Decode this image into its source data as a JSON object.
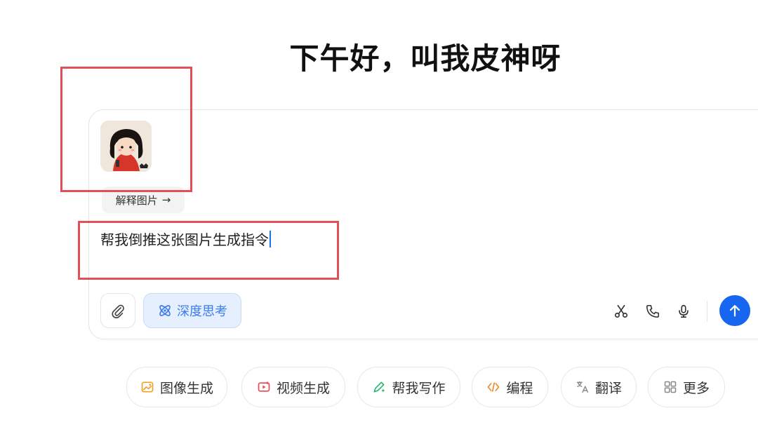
{
  "greeting": "下午好，叫我皮神呀",
  "attachment": {
    "image_icon": "cartoon-girl-image",
    "explain_chip": {
      "label": "解释图片",
      "arrow": "→"
    }
  },
  "input": {
    "value": "帮我倒推这张图片生成指令"
  },
  "toolbar": {
    "attach_icon": "paperclip-icon",
    "deep_think_label": "深度思考",
    "icons": [
      "scissors-icon",
      "phone-icon",
      "microphone-icon"
    ],
    "send_icon": "arrow-up-icon"
  },
  "quick_actions": [
    {
      "label": "图像生成",
      "icon": "image-gen-icon",
      "color": "#f0a020"
    },
    {
      "label": "视频生成",
      "icon": "video-gen-icon",
      "color": "#e5484d"
    },
    {
      "label": "帮我写作",
      "icon": "pen-icon",
      "color": "#2bb673"
    },
    {
      "label": "编程",
      "icon": "code-icon",
      "color": "#f08a24"
    },
    {
      "label": "翻译",
      "icon": "translate-icon",
      "color": "#888888"
    },
    {
      "label": "更多",
      "icon": "grid-icon",
      "color": "#888888"
    }
  ],
  "colors": {
    "accent": "#1666f0",
    "highlight_box": "#e05058",
    "deep_think_bg": "#e5effe"
  }
}
